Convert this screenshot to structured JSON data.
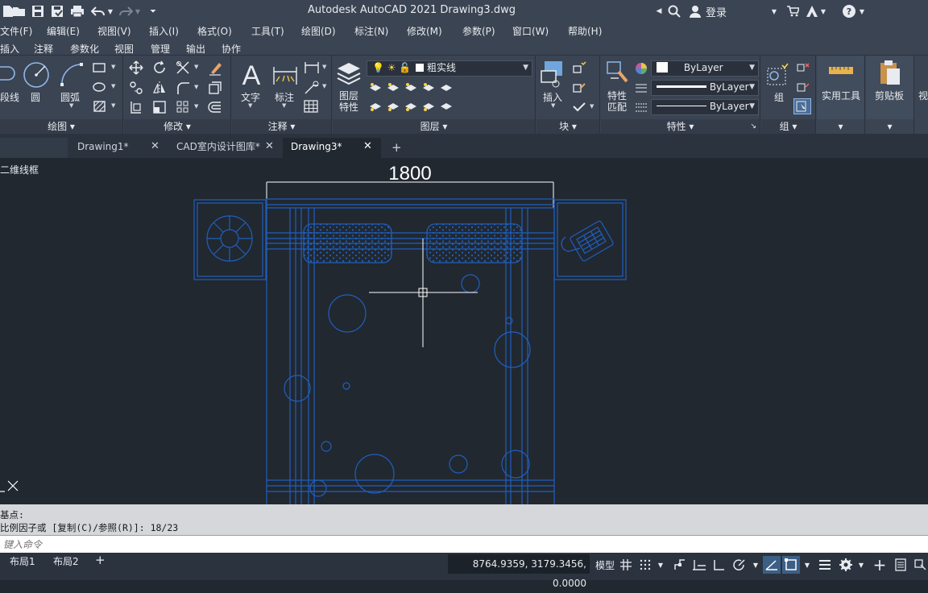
{
  "titlebar": {
    "title": "Autodesk AutoCAD 2021    Drawing3.dwg",
    "login": "登录"
  },
  "menu": [
    "文件(F)",
    "编辑(E)",
    "视图(V)",
    "插入(I)",
    "格式(O)",
    "工具(T)",
    "绘图(D)",
    "标注(N)",
    "修改(M)",
    "参数(P)",
    "窗口(W)",
    "帮助(H)"
  ],
  "ribbon_tabs": [
    "插入",
    "注释",
    "参数化",
    "视图",
    "管理",
    "输出",
    "协作"
  ],
  "ribbon": {
    "draw": {
      "title": "绘图",
      "polyline": "段线",
      "circle": "圆",
      "arc": "圆弧"
    },
    "modify": {
      "title": "修改"
    },
    "annotation": {
      "title": "注释",
      "text": "文字",
      "dimension": "标注"
    },
    "layers": {
      "title": "图层",
      "layer_props": "图层\n特性",
      "layer_props_l1": "图层",
      "layer_props_l2": "特性",
      "current_layer": "粗实线"
    },
    "block": {
      "title": "块",
      "insert": "插入"
    },
    "properties": {
      "title": "特性",
      "match_l1": "特性",
      "match_l2": "匹配",
      "color": "ByLayer",
      "linetype": "ByLayer",
      "lineweight": "ByLayer"
    },
    "groups": {
      "title": "组",
      "group": "组"
    },
    "utilities": {
      "label": "实用工具"
    },
    "clipboard": {
      "label": "剪贴板"
    },
    "view_partial": "视"
  },
  "file_tabs": [
    {
      "label": "Drawing1*"
    },
    {
      "label": "CAD室内设计图库*"
    },
    {
      "label": "Drawing3*"
    }
  ],
  "viewport": {
    "view_label": "二维线框",
    "dimension_text": "1800"
  },
  "command": {
    "line1": "基点:",
    "line2": "比例因子或 [复制(C)/参照(R)]: 18/23",
    "placeholder": "键入命令"
  },
  "status": {
    "layout_tabs": [
      "布局1",
      "布局2"
    ],
    "coordinates": "8764.9359, 3179.3456, 0.0000",
    "model": "模型"
  },
  "colors": {
    "drawing_blue": "#1f5fbf",
    "canvas_bg": "#212830",
    "ribbon_bg": "#3b4453"
  }
}
